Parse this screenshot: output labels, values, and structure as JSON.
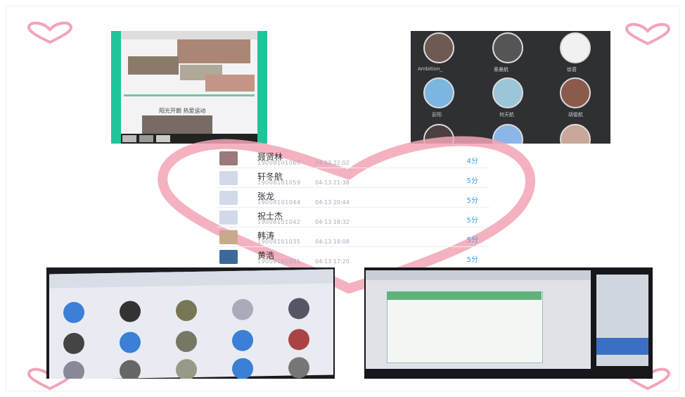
{
  "colors": {
    "accent_green": "#1fc59a",
    "link_blue": "#3aa0e0",
    "heart_pink": "#f2a4b6"
  },
  "top_left_phone": {
    "caption_primary": "",
    "caption_secondary": "阳光开朗 热爱运动"
  },
  "top_right_grid": {
    "labels": [
      "Ambition_",
      "秦晨航",
      "徐君",
      "彭阳",
      "何天航",
      "胡俊航",
      "",
      "",
      ""
    ]
  },
  "contact_list": [
    {
      "name": "聂贤林",
      "id": "19008101060",
      "time": "04-13 22:02",
      "count": "4分"
    },
    {
      "name": "轩冬航",
      "id": "19008101059",
      "time": "04-13 21:38",
      "count": "5分"
    },
    {
      "name": "张龙",
      "id": "19008101044",
      "time": "04-13 20:44",
      "count": "5分"
    },
    {
      "name": "祝士杰",
      "id": "19008101042",
      "time": "04-13 18:32",
      "count": "5分"
    },
    {
      "name": "韩涛",
      "id": "19008101035",
      "time": "04-13 18:08",
      "count": "5分"
    },
    {
      "name": "黄浩",
      "id": "19008101041",
      "time": "04-13 17:20",
      "count": "5分"
    }
  ]
}
